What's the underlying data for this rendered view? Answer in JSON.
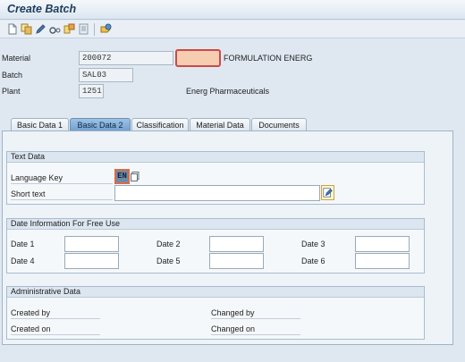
{
  "window": {
    "title": "Create Batch"
  },
  "toolbar": {
    "icons": [
      "new-document-icon",
      "copy-icon",
      "change-icon",
      "display-icon",
      "class-icon",
      "documents-icon",
      "object-services-icon"
    ]
  },
  "header": {
    "material_label": "Material",
    "material_value": "200072",
    "material_description_value": "",
    "material_description_text": "FORMULATION ENERG",
    "batch_label": "Batch",
    "batch_value": "SAL03",
    "plant_label": "Plant",
    "plant_value": "1251",
    "plant_description": "Energ Pharmaceuticals"
  },
  "tabs": [
    {
      "label": "Basic Data 1",
      "active": false
    },
    {
      "label": "Basic Data 2",
      "active": true
    },
    {
      "label": "Classification",
      "active": false
    },
    {
      "label": "Material Data",
      "active": false
    },
    {
      "label": "Documents",
      "active": false
    }
  ],
  "text_data": {
    "title": "Text Data",
    "language_key_label": "Language Key",
    "language_key_value": "EN",
    "short_text_label": "Short text",
    "short_text_value": ""
  },
  "date_info": {
    "title": "Date Information For Free Use",
    "dates": [
      {
        "label": "Date 1",
        "value": ""
      },
      {
        "label": "Date 2",
        "value": ""
      },
      {
        "label": "Date 3",
        "value": ""
      },
      {
        "label": "Date 4",
        "value": ""
      },
      {
        "label": "Date 5",
        "value": ""
      },
      {
        "label": "Date 6",
        "value": ""
      }
    ]
  },
  "admin_data": {
    "title": "Administrative Data",
    "created_by_label": "Created by",
    "created_on_label": "Created on",
    "changed_by_label": "Changed by",
    "changed_on_label": "Changed on"
  },
  "colors": {
    "active_tab": "#6f9fcf",
    "required_field_border": "#c94a4a",
    "required_field_fill": "#f7cdb1"
  }
}
